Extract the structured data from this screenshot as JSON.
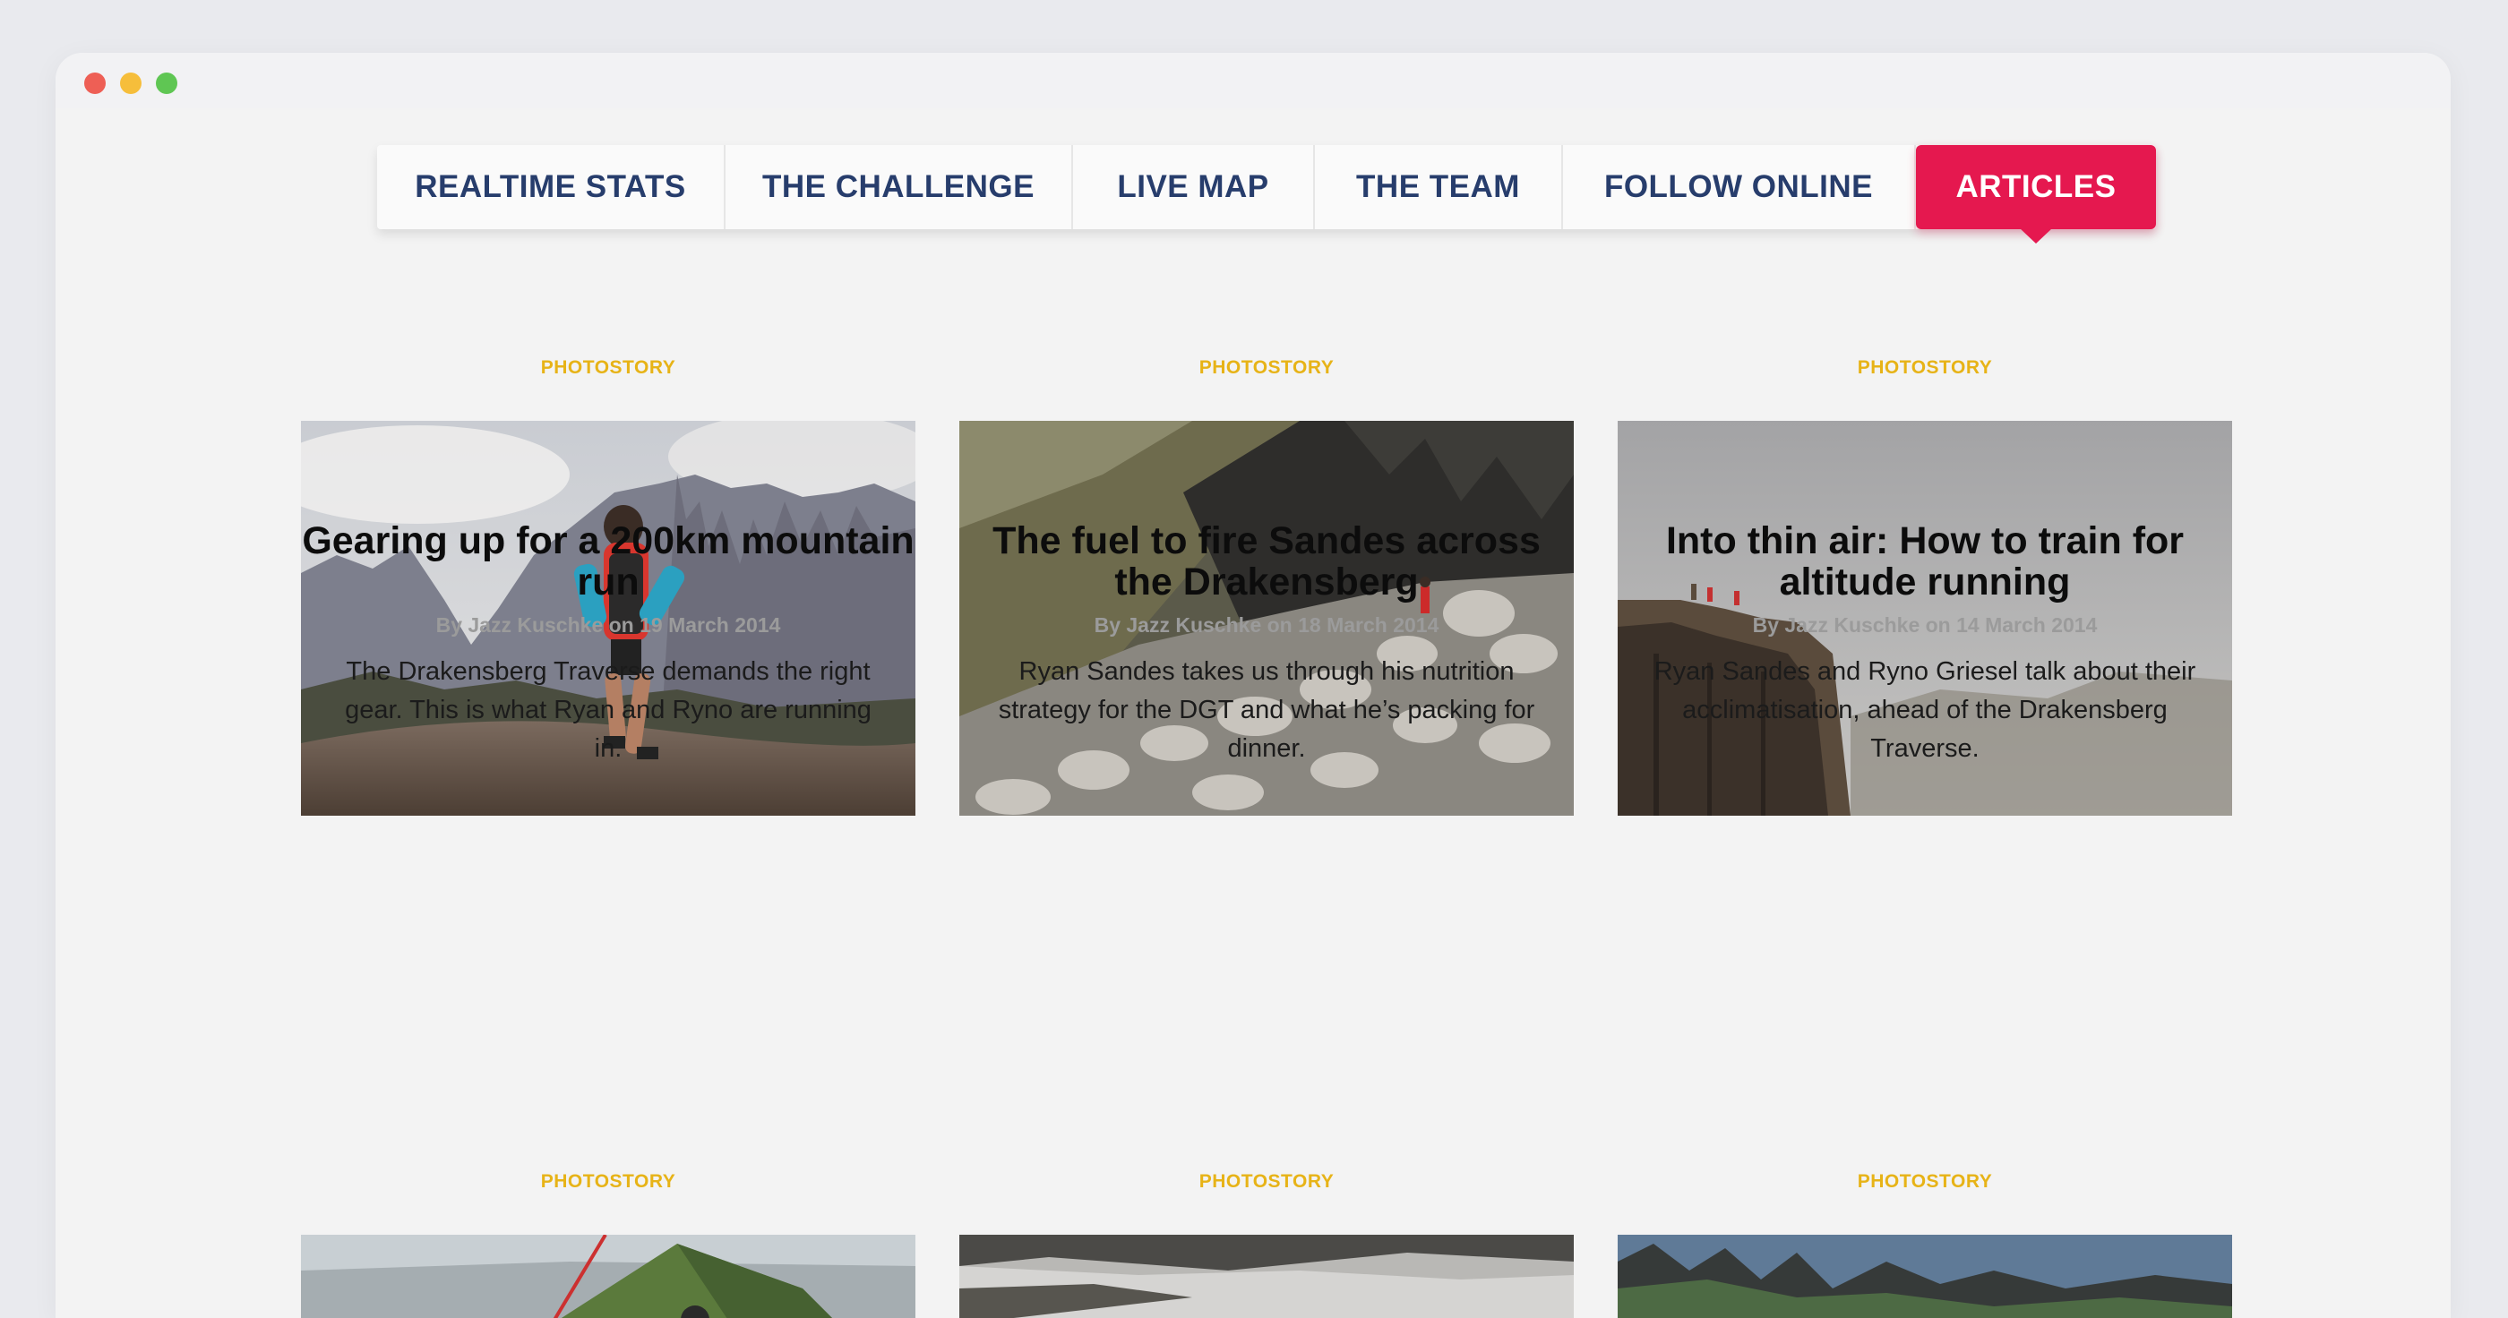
{
  "nav": {
    "items": [
      {
        "label": "REALTIME STATS"
      },
      {
        "label": "THE CHALLENGE"
      },
      {
        "label": "LIVE MAP"
      },
      {
        "label": "THE TEAM"
      },
      {
        "label": "FOLLOW ONLINE"
      },
      {
        "label": "ARTICLES"
      }
    ],
    "active": "ARTICLES"
  },
  "colors": {
    "accent": "#e5184f",
    "nav_text": "#273d6c",
    "tag": "#e7b317"
  },
  "articles": [
    {
      "tag": "PHOTOSTORY",
      "title": "Gearing up for a 200km mountain run",
      "byline": "By Jazz Kuschke on 19 March 2014",
      "excerpt": "The Drakensberg Traverse demands the right gear. This is what Ryan and Ryno are running in."
    },
    {
      "tag": "PHOTOSTORY",
      "title": "The fuel to fire Sandes across the Drakensberg",
      "byline": "By Jazz Kuschke on 18 March 2014",
      "excerpt": "Ryan Sandes takes us through his nutrition strategy for the DGT and what he’s packing for dinner."
    },
    {
      "tag": "PHOTOSTORY",
      "title": "Into thin air: How to train for altitude running",
      "byline": "By Jazz Kuschke on 14 March 2014",
      "excerpt": "Ryan Sandes and Ryno Griesel talk about their acclimatisation, ahead of the Drakensberg Traverse."
    },
    {
      "tag": "PHOTOSTORY"
    },
    {
      "tag": "PHOTOSTORY"
    },
    {
      "tag": "PHOTOSTORY"
    }
  ]
}
